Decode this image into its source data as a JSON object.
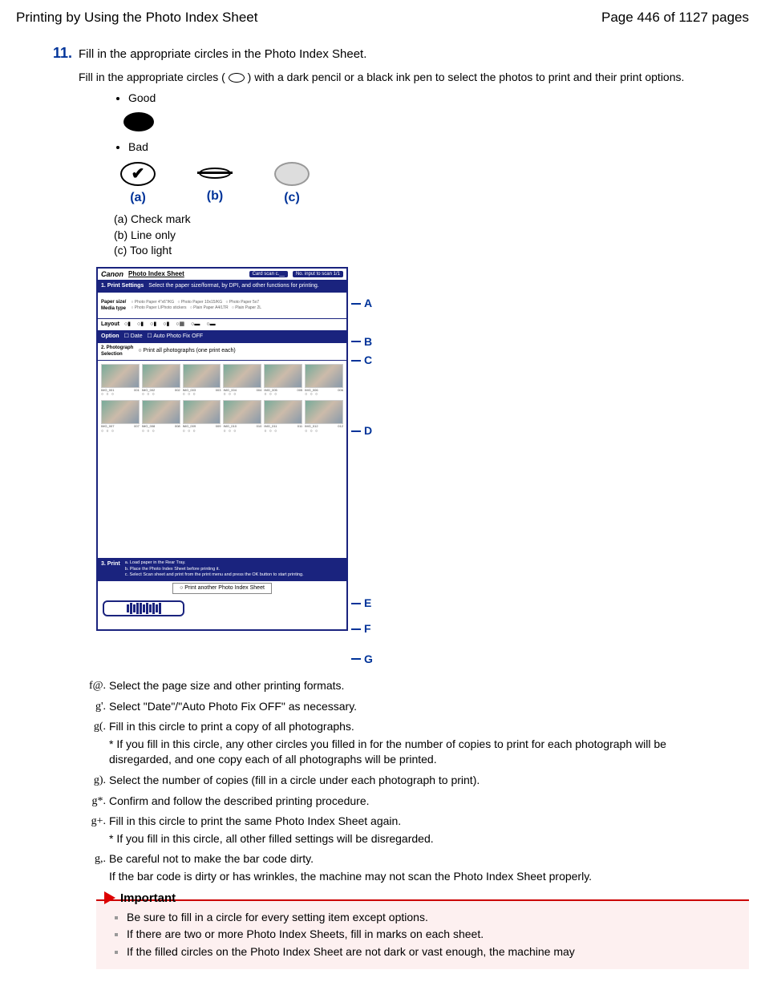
{
  "header": {
    "title": "Printing by Using the Photo Index Sheet",
    "page": "Page 446 of 1127 pages"
  },
  "step": {
    "number": "11.",
    "title": "Fill in the appropriate circles in the Photo Index Sheet.",
    "instruction_pre": "Fill in the appropriate circles ( ",
    "instruction_post": " ) with a dark pencil or a black ink pen to select the photos to print and their print options.",
    "good_label": "Good",
    "bad_label": "Bad",
    "bad_a": "(a)",
    "bad_b": "(b)",
    "bad_c": "(c)",
    "legend_a": "(a) Check mark",
    "legend_b": "(b) Line only",
    "legend_c": "(c) Too light"
  },
  "sheet": {
    "brand": "Canon",
    "title": "Photo Index Sheet",
    "chip1": "Card scan c.__",
    "chip2": "No. input to scan 1/1",
    "row1_label": "1. Print Settings",
    "row1_text": "Select the paper size/format, by DPI, and other functions for printing.",
    "row_paper": "Paper size/\nMedia type",
    "row_layout": "Layout",
    "row_option": "Option",
    "opt_date": "Date",
    "opt_auto": "Auto Photo Fix OFF",
    "row2_label": "2. Photograph\nSelection",
    "row2_text": "Print all photographs (one print each)",
    "row3_label": "3. Print",
    "row3_lines": "a. Load paper in the Rear Tray.\nb. Place the Photo Index Sheet before printing it.\nc. Select Scan sheet and print from the print menu and press the OK button to start printing.",
    "reprint": "Print another Photo Index Sheet"
  },
  "markers": {
    "A": "A",
    "B": "B",
    "C": "C",
    "D": "D",
    "E": "E",
    "F": "F",
    "G": "G"
  },
  "defs": [
    {
      "key": "f@.",
      "text": "Select the page size and other printing formats."
    },
    {
      "key": "g'.",
      "text": "Select \"Date\"/\"Auto Photo Fix OFF\" as necessary."
    },
    {
      "key": "g(.",
      "text": "Fill in this circle to print a copy of all photographs.",
      "note": "* If you fill in this circle, any other circles you filled in for the number of copies to print for each photograph will be disregarded, and one copy each of all photographs will be printed."
    },
    {
      "key": "g).",
      "text": "Select the number of copies (fill in a circle under each photograph to print)."
    },
    {
      "key": "g*.",
      "text": "Confirm and follow the described printing procedure."
    },
    {
      "key": "g+.",
      "text": "Fill in this circle to print the same Photo Index Sheet again.",
      "note": "* If you fill in this circle, all other filled settings will be disregarded."
    },
    {
      "key": "g,.",
      "text": "Be careful not to make the bar code dirty.",
      "note": "If the bar code is dirty or has wrinkles, the machine may not scan the Photo Index Sheet properly."
    }
  ],
  "important": {
    "heading": "Important",
    "items": [
      "Be sure to fill in a circle for every setting item except options.",
      "If there are two or more Photo Index Sheets, fill in marks on each sheet.",
      "If the filled circles on the Photo Index Sheet are not dark or vast enough, the machine may"
    ]
  }
}
